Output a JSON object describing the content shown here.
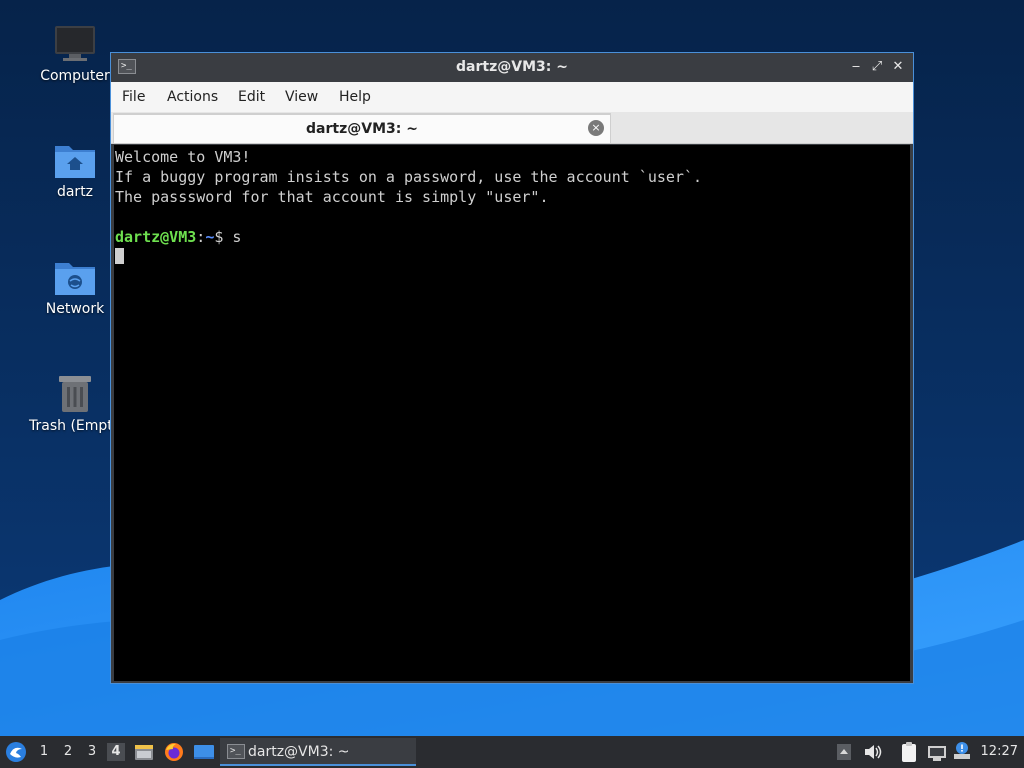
{
  "desktop": {
    "icons": [
      {
        "label": "Computer",
        "icon": "computer-icon"
      },
      {
        "label": "dartz",
        "icon": "home-folder-icon"
      },
      {
        "label": "Network",
        "icon": "network-folder-icon"
      },
      {
        "label": "Trash (Empt",
        "icon": "trash-icon"
      }
    ]
  },
  "window": {
    "title": "dartz@VM3: ~",
    "controls": {
      "minimize": "‒",
      "maximize": "⤢",
      "close": "✕"
    },
    "menu": [
      "File",
      "Actions",
      "Edit",
      "View",
      "Help"
    ],
    "tab": {
      "label": "dartz@VM3: ~",
      "close": "×"
    }
  },
  "terminal": {
    "lines": [
      "Welcome to VM3!",
      "If a buggy program insists on a password, use the account `user`.",
      "The passsword for that account is simply \"user\"."
    ],
    "prompt_user": "dartz@VM3",
    "prompt_sep": ":",
    "prompt_path": "~",
    "prompt_symbol": "$ ",
    "command": "s"
  },
  "taskbar": {
    "workspaces": [
      "1",
      "2",
      "3",
      "4"
    ],
    "active_workspace": "4",
    "task_label": "dartz@VM3: ~",
    "clock": "12:27"
  },
  "colors": {
    "accent": "#4a90d9",
    "prompt_user": "#6ee04f",
    "prompt_path": "#5a8fff",
    "desktop_dark": "#0a2a55",
    "desktop_light": "#2e8ff0"
  }
}
